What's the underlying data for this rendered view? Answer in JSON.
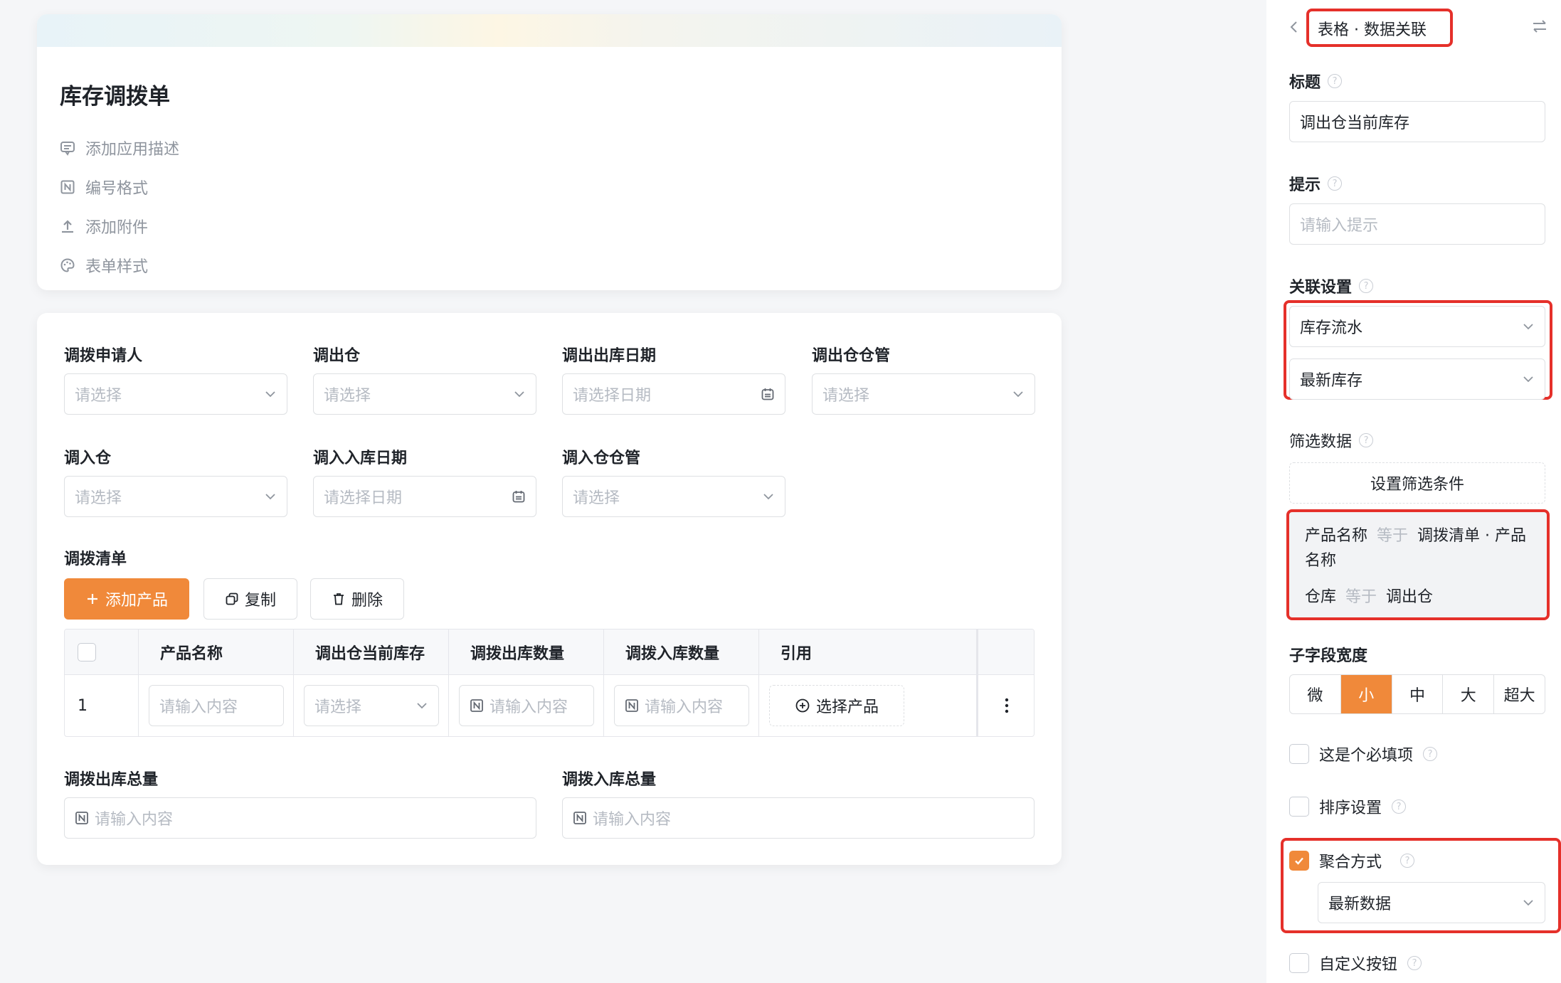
{
  "colors": {
    "accent": "#f0893a",
    "highlight": "#e5302a",
    "border": "#dee0e3",
    "placeholder": "#b6bbc3"
  },
  "header": {
    "title": "库存调拨单",
    "meta": [
      {
        "label": "添加应用描述",
        "icon": "comment-icon"
      },
      {
        "label": "编号格式",
        "icon": "number-format-icon"
      },
      {
        "label": "添加附件",
        "icon": "upload-icon"
      },
      {
        "label": "表单样式",
        "icon": "palette-icon"
      }
    ]
  },
  "form": {
    "fields": [
      {
        "label": "调拨申请人",
        "placeholder": "请选择"
      },
      {
        "label": "调出仓",
        "placeholder": "请选择"
      },
      {
        "label": "调出出库日期",
        "placeholder": "请选择日期"
      },
      {
        "label": "调出仓仓管",
        "placeholder": "请选择"
      },
      {
        "label": "调入仓",
        "placeholder": "请选择"
      },
      {
        "label": "调入入库日期",
        "placeholder": "请选择日期"
      },
      {
        "label": "调入仓仓管",
        "placeholder": "请选择"
      }
    ],
    "list": {
      "label": "调拨清单",
      "add_button": "添加产品",
      "copy_button": "复制",
      "delete_button": "删除",
      "columns": [
        "产品名称",
        "调出仓当前库存",
        "调拨出库数量",
        "调拨入库数量",
        "引用"
      ],
      "row": {
        "index": "1",
        "name_placeholder": "请输入内容",
        "stock_placeholder": "请选择",
        "out_placeholder": "请输入内容",
        "in_placeholder": "请输入内容",
        "ref_button": "选择产品"
      }
    },
    "totals": [
      {
        "label": "调拨出库总量",
        "placeholder": "请输入内容"
      },
      {
        "label": "调拨入库总量",
        "placeholder": "请输入内容"
      }
    ]
  },
  "panel": {
    "breadcrumb": "表格 · 数据关联",
    "title_label": "标题",
    "title_value": "调出仓当前库存",
    "hint_label": "提示",
    "hint_placeholder": "请输入提示",
    "relation_label": "关联设置",
    "relation_source": "库存流水",
    "relation_field": "最新库存",
    "filter_label": "筛选数据",
    "filter_button": "设置筛选条件",
    "filter_rules": [
      {
        "field": "产品名称",
        "op": "等于",
        "value": "调拨清单 · 产品名称"
      },
      {
        "field": "仓库",
        "op": "等于",
        "value": "调出仓"
      }
    ],
    "width_label": "子字段宽度",
    "widths": [
      "微",
      "小",
      "中",
      "大",
      "超大"
    ],
    "width_selected": "小",
    "required_label": "这是个必填项",
    "required_checked": false,
    "sort_label": "排序设置",
    "sort_checked": false,
    "aggregate_label": "聚合方式",
    "aggregate_checked": true,
    "aggregate_value": "最新数据",
    "custom_button_label": "自定义按钮",
    "custom_button_checked": false
  }
}
